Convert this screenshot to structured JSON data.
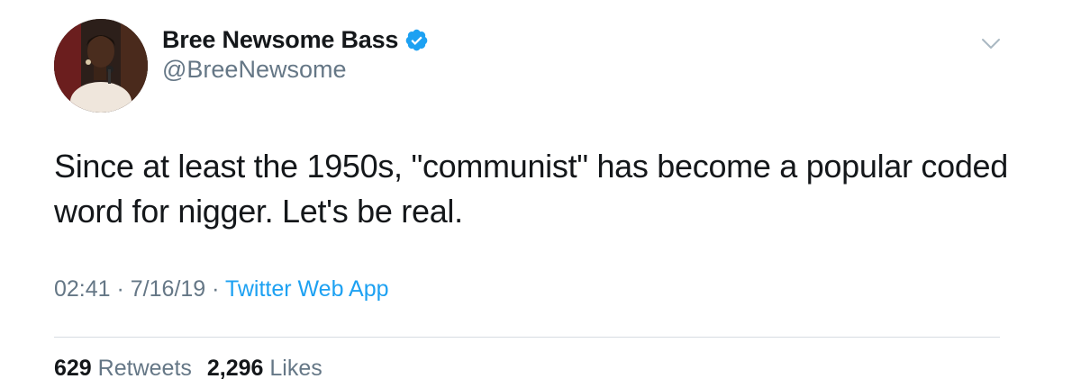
{
  "author": {
    "display_name": "Bree Newsome Bass",
    "handle": "@BreeNewsome",
    "verified_icon": "verified-badge-icon",
    "avatar_icon": "profile-photo"
  },
  "tweet": {
    "text": "Since at least the 1950s, \"communist\" has become a popular coded word for nigger. Let's be real."
  },
  "meta": {
    "time": "02:41",
    "separator": " · ",
    "date": "7/16/19",
    "source": "Twitter Web App"
  },
  "stats": {
    "retweets_count": "629",
    "retweets_label": "Retweets",
    "likes_count": "2,296",
    "likes_label": "Likes"
  },
  "menu": {
    "icon": "chevron-down-icon"
  },
  "colors": {
    "accent": "#1da1f2",
    "secondary_text": "#657786",
    "primary_text": "#14171a",
    "divider": "#d7dde2"
  }
}
